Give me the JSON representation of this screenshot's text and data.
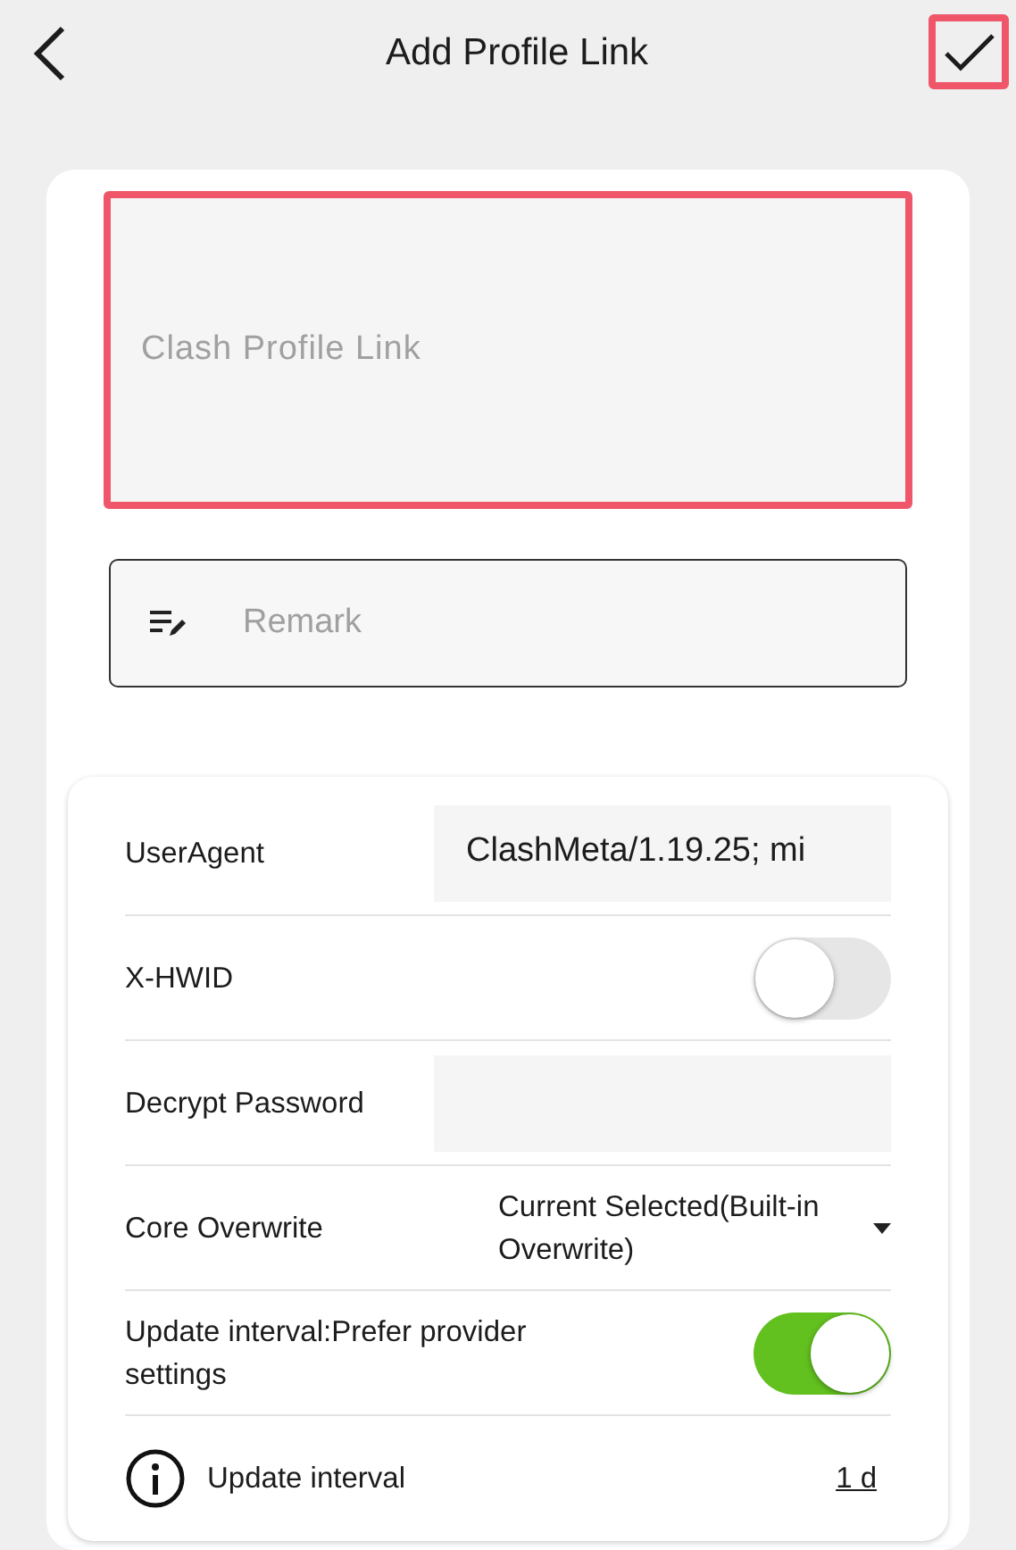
{
  "header": {
    "title": "Add Profile Link",
    "confirm_highlighted": true
  },
  "link_field": {
    "placeholder": "Clash Profile Link",
    "highlighted": true
  },
  "remark_field": {
    "placeholder": "Remark"
  },
  "settings": [
    {
      "kind": "input",
      "label": "UserAgent",
      "value": "ClashMeta/1.19.25; mi"
    },
    {
      "kind": "switch",
      "label": "X-HWID",
      "on": false
    },
    {
      "kind": "input",
      "label": "Decrypt Password"
    },
    {
      "kind": "dropdown",
      "label": "Core Overwrite",
      "value": "Current Selected(Built-in Overwrite)"
    },
    {
      "kind": "switch",
      "label": "Update interval:Prefer provider settings",
      "on": true
    },
    {
      "kind": "link",
      "label": "Update interval",
      "value": "1 d"
    }
  ]
}
